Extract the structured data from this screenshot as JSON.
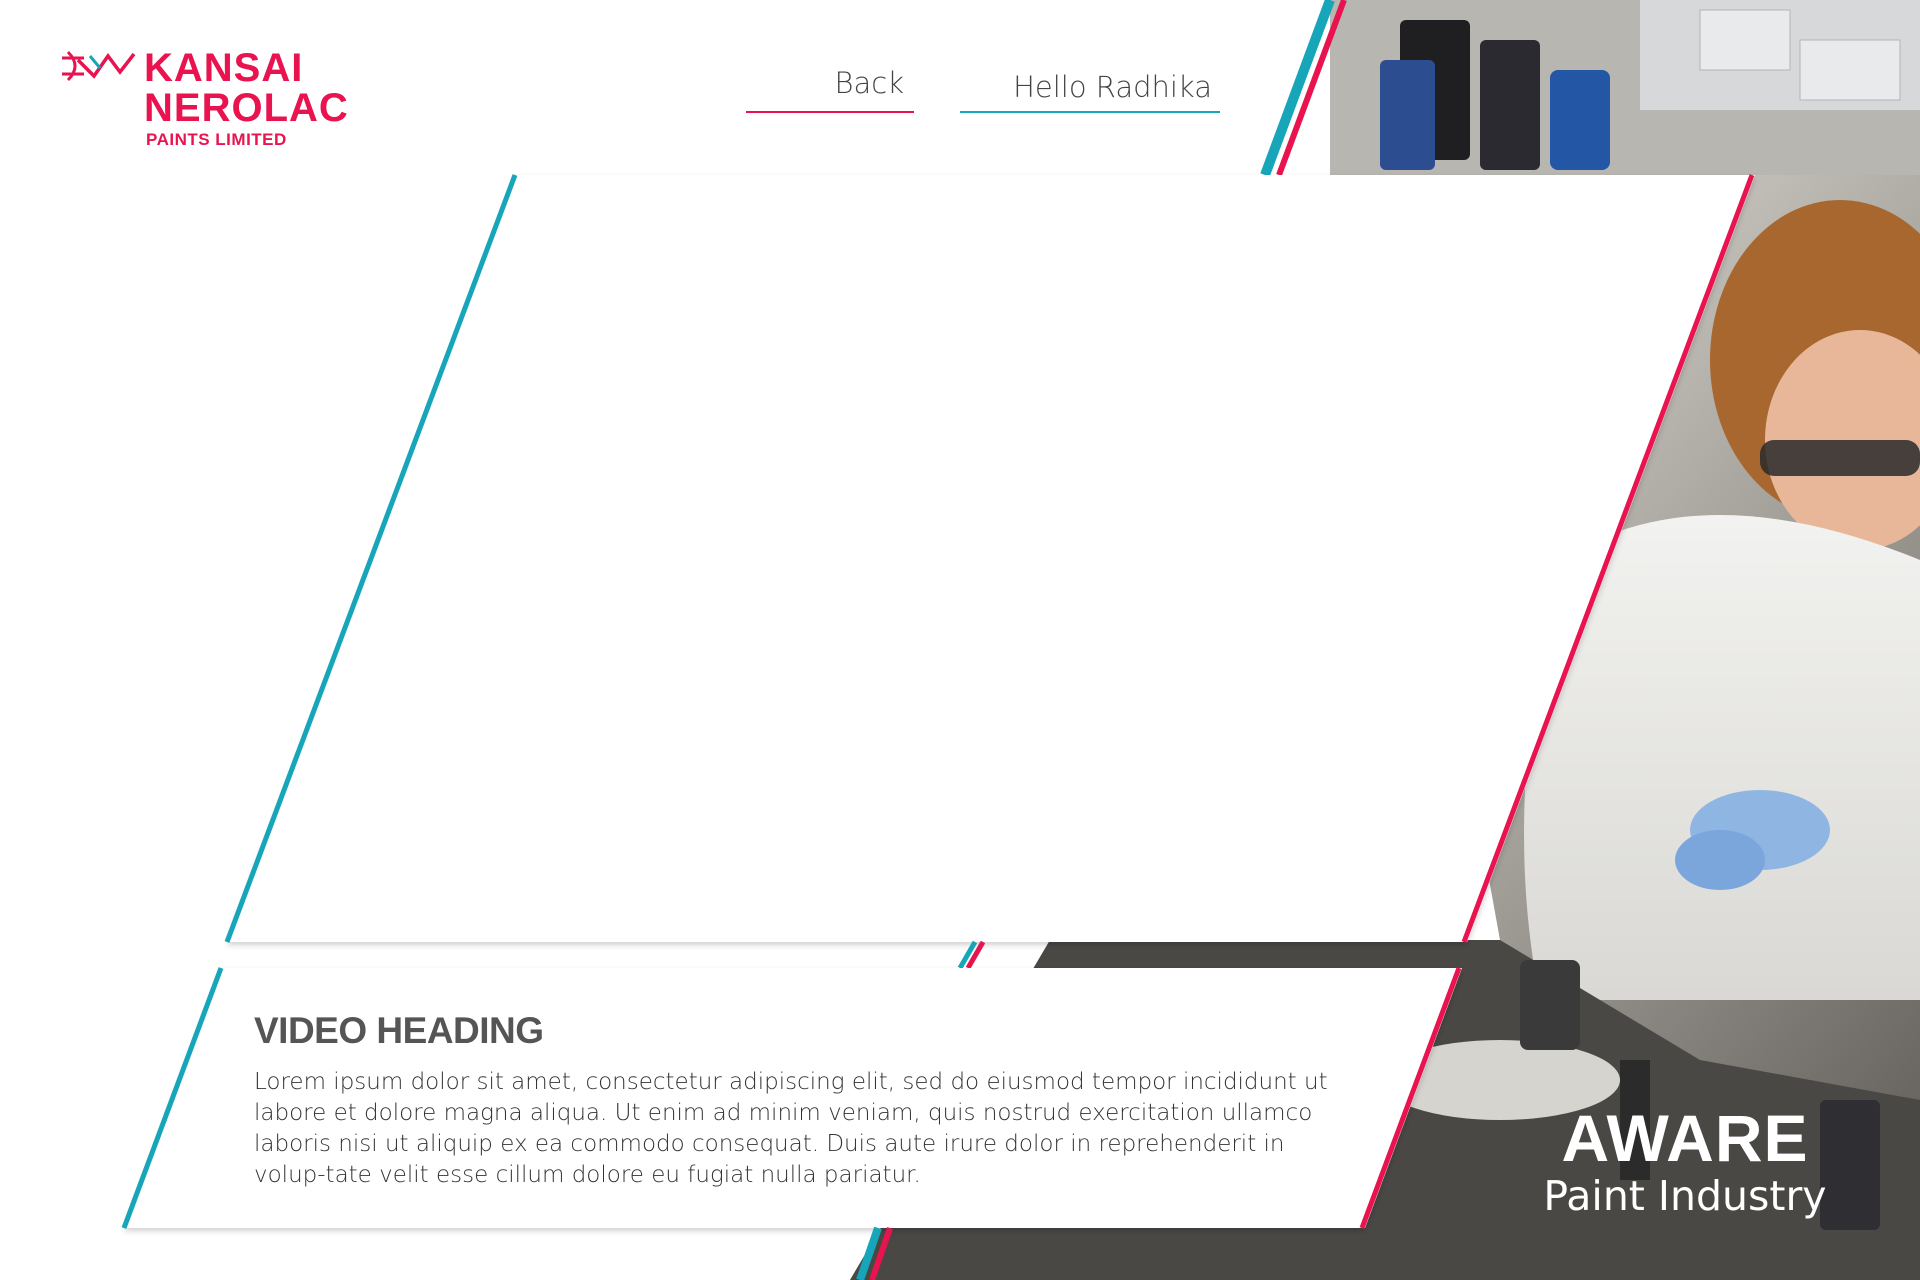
{
  "brand": {
    "line1": "KANSAI",
    "line2": "NEROLAC",
    "line3": "PAINTS LIMITED",
    "color": "#e8134f"
  },
  "nav": {
    "back_label": "Back",
    "greeting": "Hello Radhika"
  },
  "video": {
    "heading": "VIDEO HEADING",
    "description": "Lorem ipsum dolor sit amet, consectetur adipiscing elit, sed do eiusmod tempor incididunt ut labore et dolore magna aliqua. Ut enim ad minim veniam, quis nostrud exercitation ullamco laboris nisi ut aliquip ex ea commodo consequat. Duis aute irure dolor in reprehenderit in volup-tate velit esse cillum dolore eu fugiat nulla pariatur."
  },
  "section": {
    "title": "AWARE",
    "subtitle": "Paint Industry"
  },
  "colors": {
    "accent_pink": "#e8134f",
    "accent_teal": "#17a5b9",
    "heading_gray": "#555555"
  }
}
